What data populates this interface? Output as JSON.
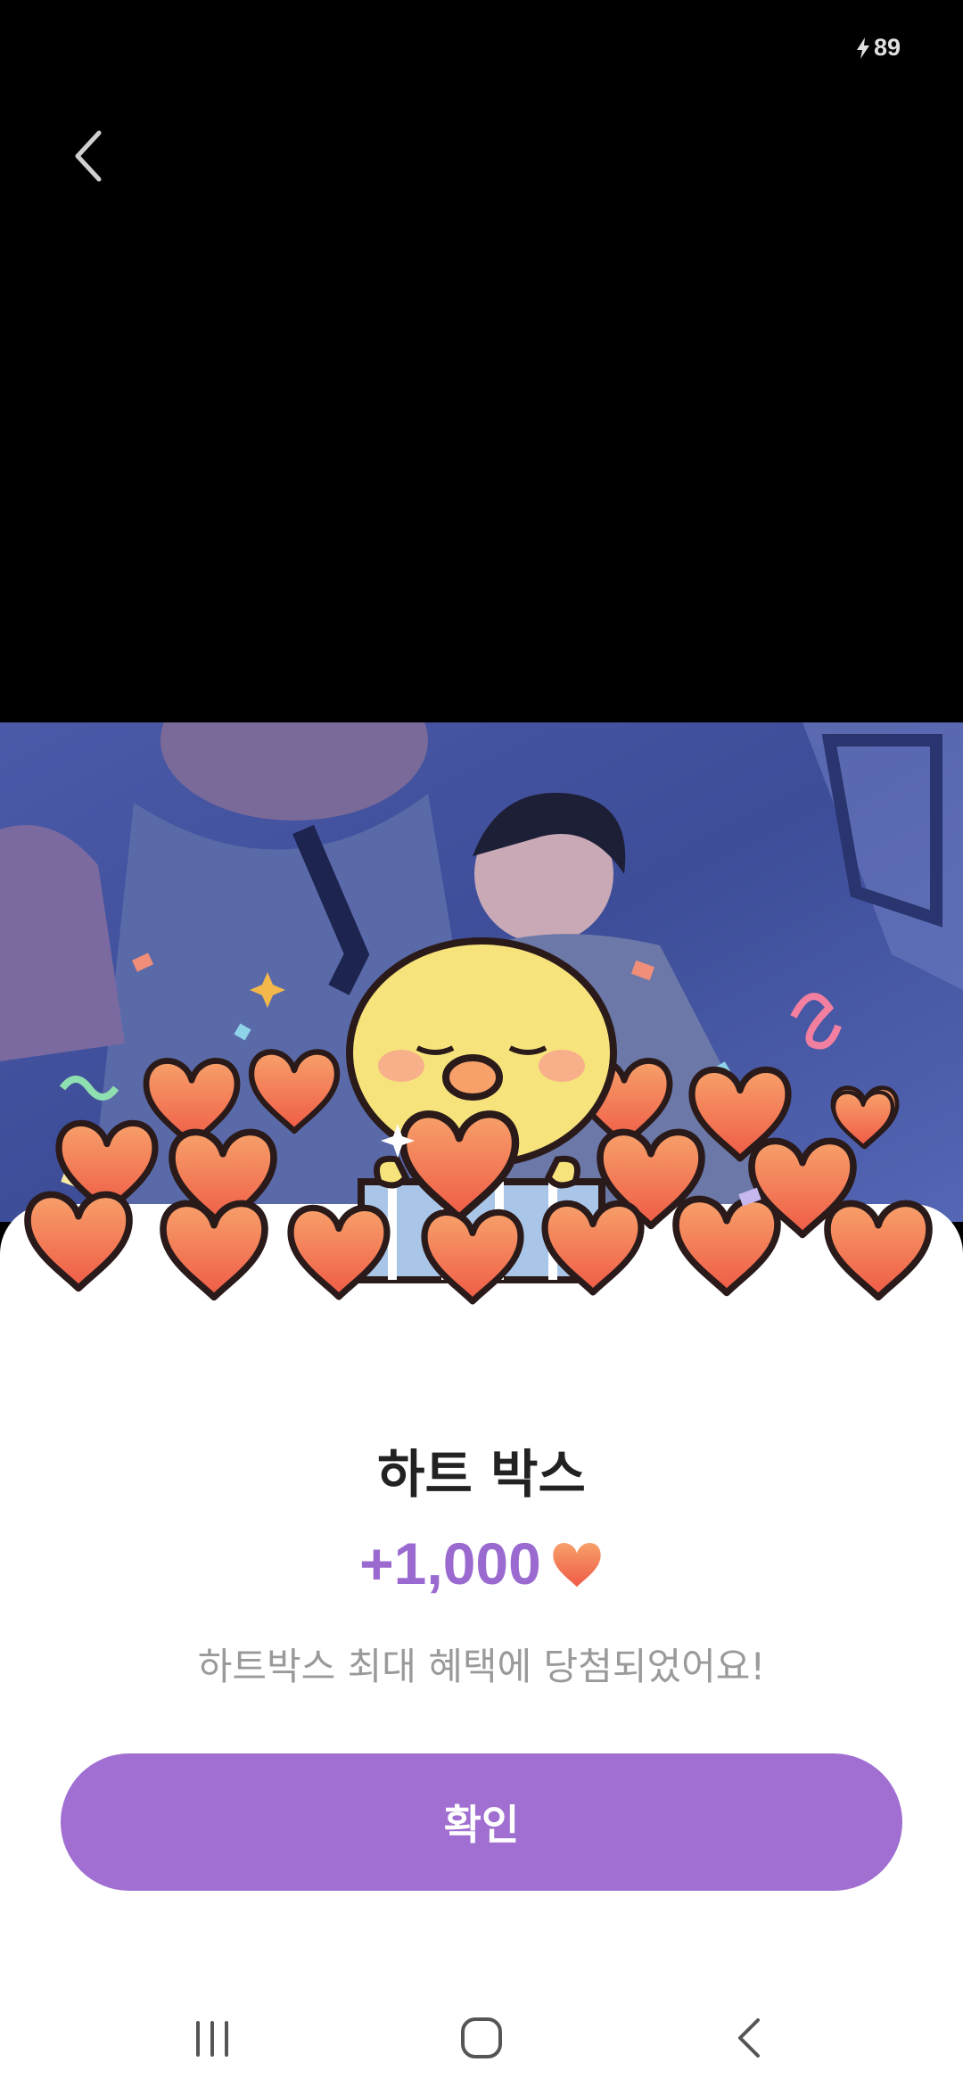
{
  "status": {
    "battery": "89"
  },
  "header": {
    "back_icon": "chevron-left-icon"
  },
  "popup": {
    "title": "하트 박스",
    "amount": "+1,000",
    "amount_icon": "heart-icon",
    "message": "하트박스 최대 혜택에 당첨되었어요!",
    "confirm_label": "확인"
  },
  "nav": {
    "recents_icon": "recents-icon",
    "home_icon": "home-icon",
    "back_icon": "back-icon"
  },
  "colors": {
    "accent": "#a06fd1",
    "amount": "#9b6ad0",
    "heart": "#f26d50"
  }
}
